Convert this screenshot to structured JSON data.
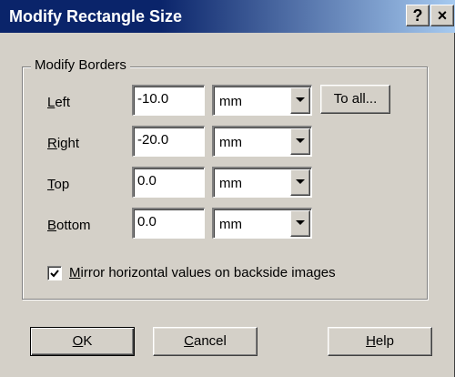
{
  "window": {
    "title": "Modify Rectangle Size",
    "help_label": "?",
    "close_label": "×"
  },
  "group": {
    "title": "Modify Borders"
  },
  "rows": [
    {
      "label_accel": "L",
      "label_rest": "eft",
      "value": "-10.0",
      "unit": "mm"
    },
    {
      "label_accel": "R",
      "label_rest": "ight",
      "value": "-20.0",
      "unit": "mm"
    },
    {
      "label_accel": "T",
      "label_rest": "op",
      "value": "0.0",
      "unit": "mm"
    },
    {
      "label_accel": "B",
      "label_rest": "ottom",
      "value": "0.0",
      "unit": "mm"
    }
  ],
  "to_all_label": "To all...",
  "mirror": {
    "checked": true,
    "label_accel": "M",
    "label_rest": "irror horizontal values on backside images"
  },
  "buttons": {
    "ok_accel": "O",
    "ok_rest": "K",
    "cancel_accel": "C",
    "cancel_rest": "ancel",
    "help_accel": "H",
    "help_rest": "elp"
  }
}
